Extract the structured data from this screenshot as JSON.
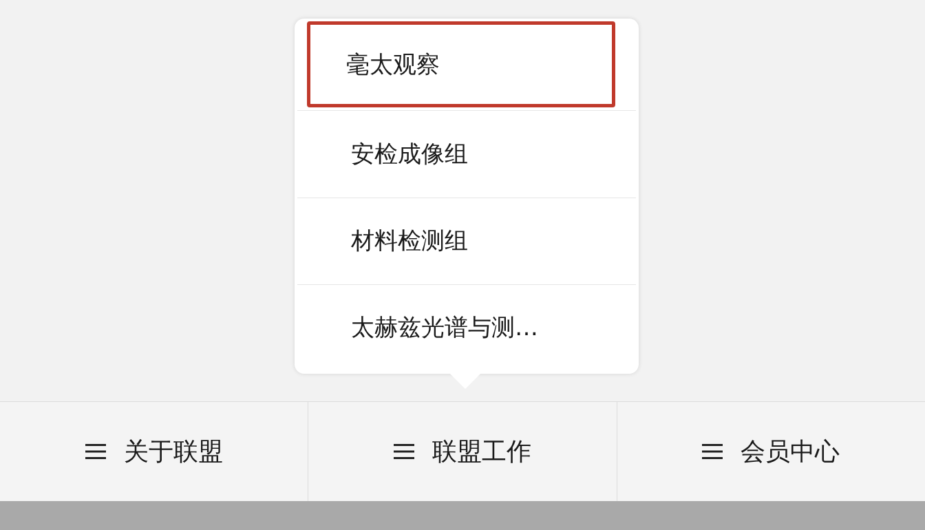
{
  "menu": {
    "items": [
      {
        "label": "毫太观察",
        "selected": true
      },
      {
        "label": "安检成像组",
        "selected": false
      },
      {
        "label": "材料检测组",
        "selected": false
      },
      {
        "label": "太赫兹光谱与测…",
        "selected": false
      }
    ]
  },
  "tabs": [
    {
      "label": "关于联盟"
    },
    {
      "label": "联盟工作"
    },
    {
      "label": "会员中心"
    }
  ]
}
